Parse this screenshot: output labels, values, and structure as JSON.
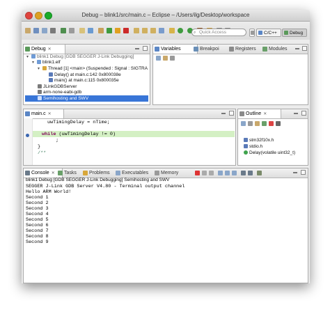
{
  "window": {
    "title": "Debug – blink1/src/main.c – Eclipse – /Users/ilg/Desktop/workspace"
  },
  "toolbar": {
    "quick_access_placeholder": "Quick Access",
    "perspectives": [
      {
        "label": "C/C++"
      },
      {
        "label": "Debug"
      }
    ]
  },
  "debug_view": {
    "tab_label": "Debug",
    "rows": [
      {
        "label": "blink1 Debug [GDB SEGGER J-Link Debugging]"
      },
      {
        "label": "blink1.elf"
      },
      {
        "label": "Thread [1] <main> (Suspended : Signal : SIGTRA"
      },
      {
        "label": "Delay() at main.c:142 0x800038e"
      },
      {
        "label": "main() at main.c:115 0x800035e"
      },
      {
        "label": "JLinkGDBServer"
      },
      {
        "label": "arm-none-eabi-gdb"
      },
      {
        "label": "Semihosting and SWV"
      }
    ]
  },
  "variables_view": {
    "tabs": [
      {
        "label": "Variables"
      },
      {
        "label": "Breakpoi"
      },
      {
        "label": "Registers"
      },
      {
        "label": "Modules"
      }
    ]
  },
  "editor": {
    "tab_label": "main.c",
    "lines": [
      {
        "text": "uwTimingDelay = nTime;"
      },
      {
        "text": ""
      },
      {
        "text": "while (uwTimingDelay != 0)"
      },
      {
        "text": "  ;"
      },
      {
        "text": "}"
      },
      {
        "text": "/**"
      }
    ]
  },
  "outline_view": {
    "tab_label": "Outline",
    "items": [
      {
        "label": "stm32f10x.h"
      },
      {
        "label": "stdio.h"
      },
      {
        "label": "Delay(volatile uint32_t)"
      }
    ]
  },
  "console_view": {
    "tabs": [
      {
        "label": "Console"
      },
      {
        "label": "Tasks"
      },
      {
        "label": "Problems"
      },
      {
        "label": "Executables"
      },
      {
        "label": "Memory"
      }
    ],
    "header": "blink1 Debug [GDB SEGGER J-Link Debugging] Semihosting and SWV",
    "lines": [
      {
        "text": "SEGGER J-Link GDB Server V4.80 - Terminal output channel"
      },
      {
        "text": "Hello ARM World!"
      },
      {
        "text": "Second 1"
      },
      {
        "text": "Second 2"
      },
      {
        "text": "Second 3"
      },
      {
        "text": "Second 4"
      },
      {
        "text": "Second 5"
      },
      {
        "text": "Second 6"
      },
      {
        "text": "Second 7"
      },
      {
        "text": "Second 8"
      },
      {
        "text": "Second 9"
      }
    ]
  },
  "colors": {
    "selection": "#3875d7",
    "current_line": "#d4f0c4",
    "keyword": "#7f0055",
    "close_button": "#e0443e"
  }
}
